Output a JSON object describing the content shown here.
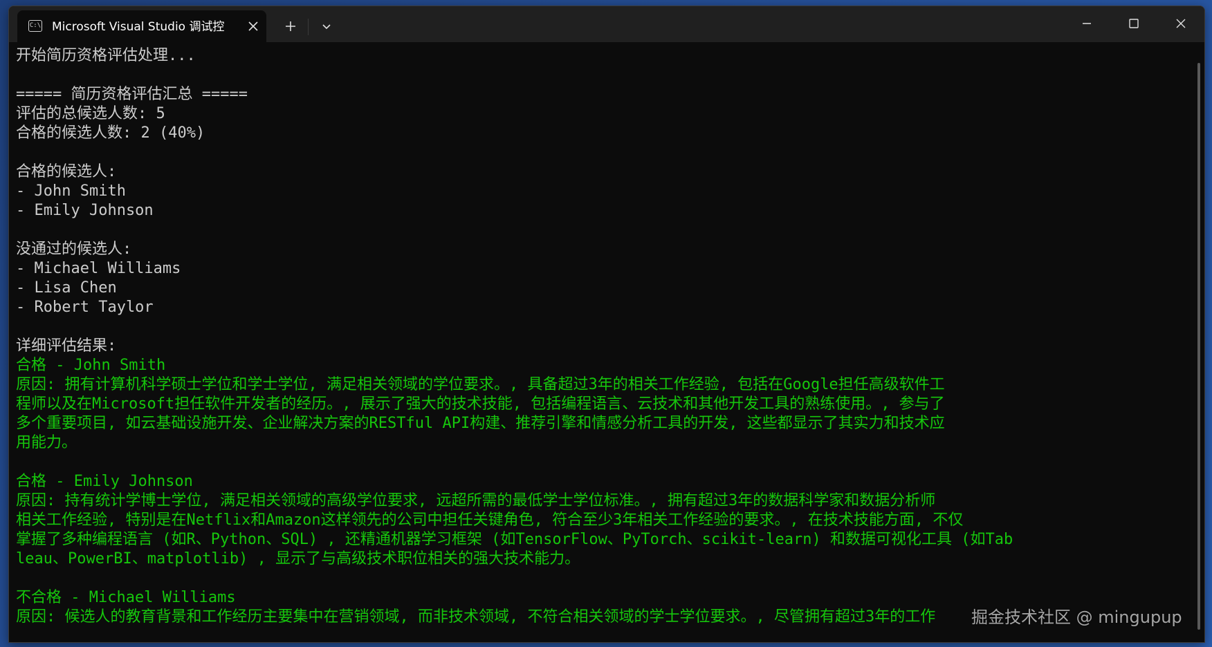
{
  "window": {
    "tab_title": "Microsoft Visual Studio 调试控",
    "tab_icon": "console-app-icon",
    "new_tab_icon": "plus-icon",
    "dropdown_icon": "chevron-down-icon",
    "controls": [
      "minimize-icon",
      "maximize-icon",
      "close-icon"
    ]
  },
  "console": {
    "default_color": "#cccccc",
    "accent_color": "#16c60c",
    "lines": [
      {
        "text": "开始简历资格评估处理...",
        "color": "white"
      },
      {
        "text": "",
        "color": "white"
      },
      {
        "text": "===== 简历资格评估汇总 =====",
        "color": "white"
      },
      {
        "text": "评估的总候选人数: 5",
        "color": "white"
      },
      {
        "text": "合格的候选人数: 2 (40%)",
        "color": "white"
      },
      {
        "text": "",
        "color": "white"
      },
      {
        "text": "合格的候选人:",
        "color": "white"
      },
      {
        "text": "- John Smith",
        "color": "white"
      },
      {
        "text": "- Emily Johnson",
        "color": "white"
      },
      {
        "text": "",
        "color": "white"
      },
      {
        "text": "没通过的候选人:",
        "color": "white"
      },
      {
        "text": "- Michael Williams",
        "color": "white"
      },
      {
        "text": "- Lisa Chen",
        "color": "white"
      },
      {
        "text": "- Robert Taylor",
        "color": "white"
      },
      {
        "text": "",
        "color": "white"
      },
      {
        "text": "详细评估结果:",
        "color": "white"
      },
      {
        "text": "合格 - John Smith",
        "color": "green"
      },
      {
        "text": "原因: 拥有计算机科学硕士学位和学士学位, 满足相关领域的学位要求。, 具备超过3年的相关工作经验, 包括在Google担任高级软件工",
        "color": "green"
      },
      {
        "text": "程师以及在Microsoft担任软件开发者的经历。, 展示了强大的技术技能, 包括编程语言、云技术和其他开发工具的熟练使用。, 参与了",
        "color": "green"
      },
      {
        "text": "多个重要项目, 如云基础设施开发、企业解决方案的RESTful API构建、推荐引擎和情感分析工具的开发, 这些都显示了其实力和技术应",
        "color": "green"
      },
      {
        "text": "用能力。",
        "color": "green"
      },
      {
        "text": "",
        "color": "green"
      },
      {
        "text": "合格 - Emily Johnson",
        "color": "green"
      },
      {
        "text": "原因: 持有统计学博士学位, 满足相关领域的高级学位要求, 远超所需的最低学士学位标准。, 拥有超过3年的数据科学家和数据分析师",
        "color": "green"
      },
      {
        "text": "相关工作经验, 特别是在Netflix和Amazon这样领先的公司中担任关键角色, 符合至少3年相关工作经验的要求。, 在技术技能方面, 不仅",
        "color": "green"
      },
      {
        "text": "掌握了多种编程语言 (如R、Python、SQL) , 还精通机器学习框架 (如TensorFlow、PyTorch、scikit-learn) 和数据可视化工具 (如Tab",
        "color": "green"
      },
      {
        "text": "leau、PowerBI、matplotlib) , 显示了与高级技术职位相关的强大技术能力。",
        "color": "green"
      },
      {
        "text": "",
        "color": "green"
      },
      {
        "text": "不合格 - Michael Williams",
        "color": "green"
      },
      {
        "text": "原因: 候选人的教育背景和工作经历主要集中在营销领域, 而非技术领域, 不符合相关领域的学士学位要求。, 尽管拥有超过3年的工作",
        "color": "green"
      }
    ]
  },
  "watermark": "掘金技术社区 @ mingupup"
}
